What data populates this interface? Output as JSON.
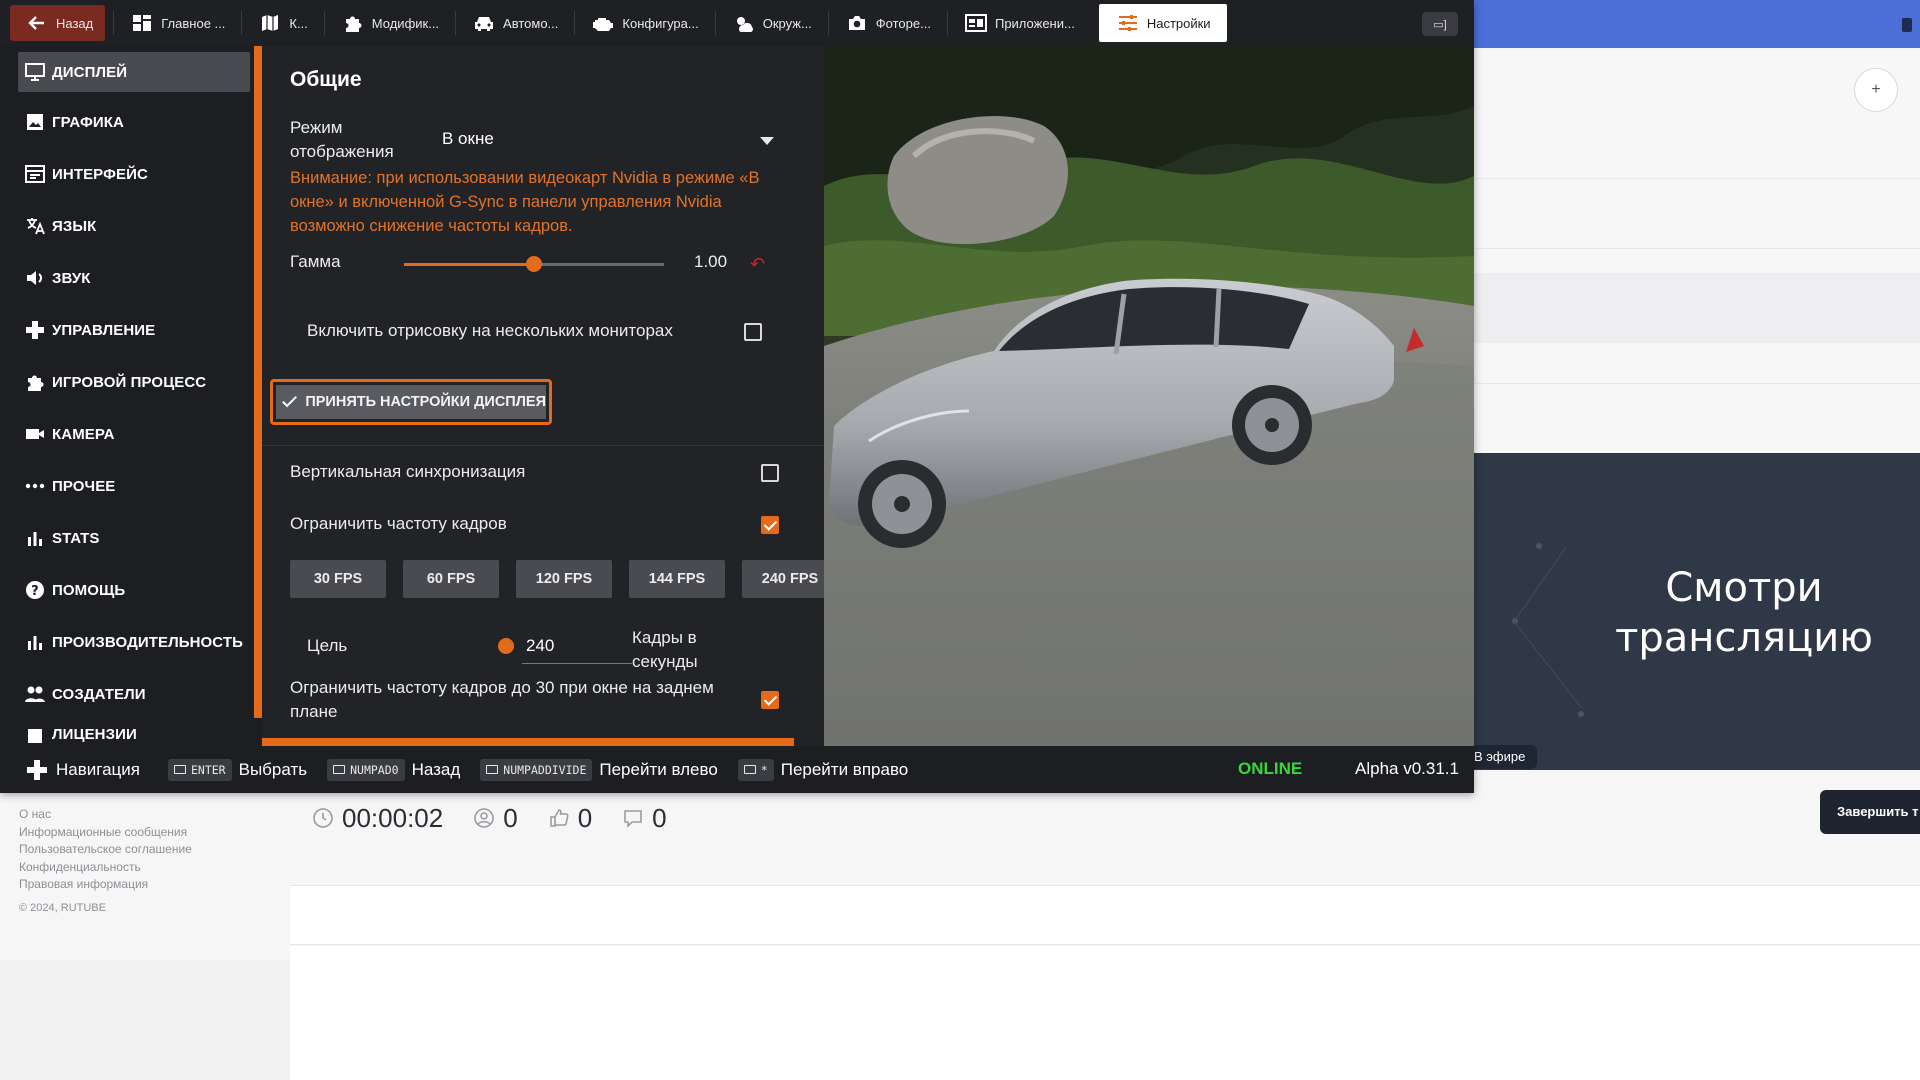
{
  "web": {
    "stream_banner_title": "Смотри трансляцию",
    "live_badge": "В эфире",
    "end_button": "Завершить т",
    "footer_links": [
      "О нас",
      "Информационные сообщения",
      "Пользовательское соглашение",
      "Конфиденциальность",
      "Правовая информация"
    ],
    "copyright": "© 2024, RUTUBE",
    "stats": {
      "timer": "00:00:02",
      "viewers": "0",
      "likes": "0",
      "dislikes": "0"
    }
  },
  "game": {
    "top_tabs": [
      {
        "label": "Назад",
        "icon": "arrow-left-icon"
      },
      {
        "label": "Главное ...",
        "icon": "dashboard-icon"
      },
      {
        "label": "К...",
        "icon": "map-icon"
      },
      {
        "label": "Модифик...",
        "icon": "puzzle-icon"
      },
      {
        "label": "Автомо...",
        "icon": "car-icon"
      },
      {
        "label": "Конфигура...",
        "icon": "engine-icon"
      },
      {
        "label": "Окруж...",
        "icon": "weather-icon"
      },
      {
        "label": "Фоторе...",
        "icon": "camera-icon"
      },
      {
        "label": "Приложени...",
        "icon": "apps-icon"
      },
      {
        "label": "Настройки",
        "icon": "sliders-icon"
      }
    ],
    "sidebar": [
      {
        "label": "Дисплей",
        "icon": "monitor-icon",
        "active": true
      },
      {
        "label": "Графика",
        "icon": "image-icon"
      },
      {
        "label": "Интерфейс",
        "icon": "interface-icon"
      },
      {
        "label": "Язык",
        "icon": "translate-icon"
      },
      {
        "label": "Звук",
        "icon": "speaker-icon"
      },
      {
        "label": "Управление",
        "icon": "gamepad-icon"
      },
      {
        "label": "Игровой процесс",
        "icon": "puzzle-icon"
      },
      {
        "label": "Камера",
        "icon": "video-camera-icon"
      },
      {
        "label": "Прочее",
        "icon": "more-icon"
      },
      {
        "label": "Stats",
        "icon": "bar-chart-icon"
      },
      {
        "label": "Помощь",
        "icon": "help-icon"
      },
      {
        "label": "Производительность",
        "icon": "bar-chart-icon"
      },
      {
        "label": "Создатели",
        "icon": "people-icon"
      },
      {
        "label": "Лицензии",
        "icon": "license-icon"
      }
    ],
    "settings": {
      "section_title": "Общие",
      "display_mode_label": "Режим отображения",
      "display_mode_value": "В окне",
      "warning": "Внимание: при использовании видеокарт Nvidia в режиме «В окне» и включенной G-Sync в панели управления Nvidia возможно снижение частоты кадров.",
      "gamma_label": "Гамма",
      "gamma_value": "1.00",
      "gamma_fraction": 0.5,
      "multi_monitor_label": "Включить отрисовку на нескольких мониторах",
      "multi_monitor_checked": false,
      "apply_button": "ПРИНЯТЬ НАСТРОЙКИ ДИСПЛЕЯ",
      "vsync_label": "Вертикальная синхронизация",
      "vsync_checked": false,
      "limit_fps_label": "Ограничить частоту кадров",
      "limit_fps_checked": true,
      "fps_presets": [
        "30 FPS",
        "60 FPS",
        "120 FPS",
        "144 FPS",
        "240 FPS"
      ],
      "target_label": "Цель",
      "target_value": "240",
      "target_unit": "Кадры в секунды",
      "bg_limit_label": "Ограничить частоту кадров до 30 при окне на заднем плане",
      "bg_limit_checked": true
    },
    "bottom_bar": {
      "navigation": "Навигация",
      "hints": [
        {
          "key": "ENTER",
          "label": "Выбрать"
        },
        {
          "key": "NUMPAD0",
          "label": "Назад"
        },
        {
          "key": "NUMPADDIVIDE",
          "label": "Перейти влево"
        },
        {
          "key": "*",
          "label": "Перейти вправо"
        }
      ],
      "status": "ONLINE",
      "version": "Alpha v0.31.1"
    }
  },
  "colors": {
    "accent": "#e46a1c",
    "online": "#39d63c",
    "warning": "#e0732c",
    "banner_bg": "#2f3846"
  }
}
